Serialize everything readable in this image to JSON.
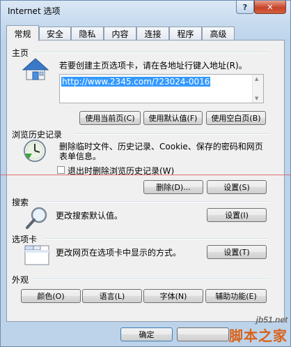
{
  "window": {
    "title": "Internet 选项",
    "help_label": "?",
    "close_label": "✕"
  },
  "tabs": [
    "常规",
    "安全",
    "隐私",
    "内容",
    "连接",
    "程序",
    "高级"
  ],
  "home": {
    "section_label": "主页",
    "instruction": "若要创建主页选项卡，请在各地址行键入地址(R)。",
    "url": "http://www.2345.com/?23024-0016",
    "buttons": [
      "使用当前页(C)",
      "使用默认值(F)",
      "使用空白页(B)"
    ],
    "icon": "house-icon"
  },
  "history": {
    "section_label": "浏览历史记录",
    "description_line1": "删除临时文件、历史记录、Cookie、保存的密码和网页",
    "description_line2": "表单信息。",
    "checkbox_label": "退出时删除浏览历史记录(W)",
    "delete_button": "删除(D)...",
    "settings_button": "设置(S)",
    "icon": "clock-icon"
  },
  "search": {
    "section_label": "搜索",
    "description": "更改搜索默认值。",
    "settings_button": "设置(I)",
    "icon": "magnifier-icon"
  },
  "tabs_section": {
    "section_label": "选项卡",
    "description": "更改网页在选项卡中显示的方式。",
    "settings_button": "设置(T)",
    "icon": "tabbed-window-icon"
  },
  "appearance": {
    "section_label": "外观",
    "buttons": [
      "颜色(O)",
      "语言(L)",
      "字体(N)",
      "辅助功能(E)"
    ]
  },
  "footer": {
    "ok_button": "确定"
  },
  "watermark": {
    "line1": "jb51.net",
    "line2": "脚本之家"
  }
}
